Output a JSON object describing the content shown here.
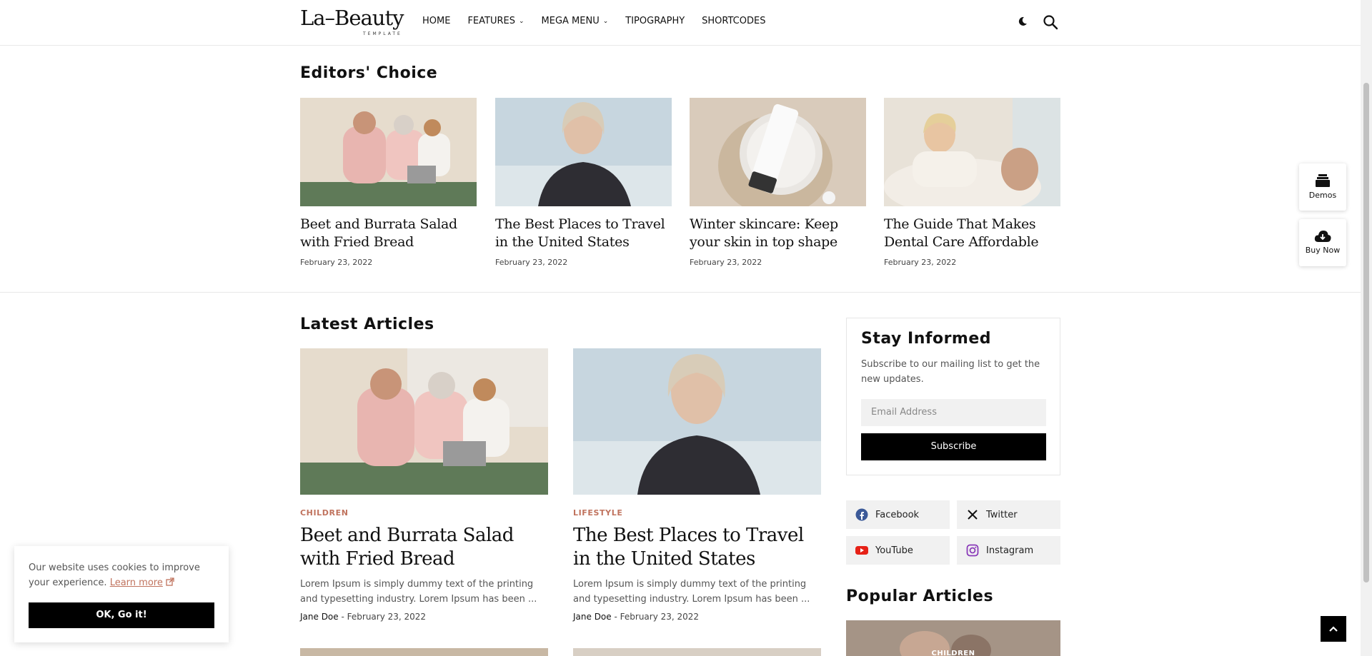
{
  "header": {
    "logo_text": "La–Beauty",
    "logo_sub": "TEMPLATE",
    "nav": [
      {
        "label": "HOME"
      },
      {
        "label": "FEATURES"
      },
      {
        "label": "MEGA MENU"
      },
      {
        "label": "TIPOGRAPHY"
      },
      {
        "label": "SHORTCODES"
      }
    ]
  },
  "editors": {
    "title": "Editors' Choice",
    "items": [
      {
        "title": "Beet and Burrata Salad with Fried Bread",
        "date": "February 23, 2022"
      },
      {
        "title": "The Best Places to Travel in the United States",
        "date": "February 23, 2022"
      },
      {
        "title": "Winter skincare: Keep your skin in top shape",
        "date": "February 23, 2022"
      },
      {
        "title": "The Guide That Makes Dental Care Affordable",
        "date": "February 23, 2022"
      }
    ]
  },
  "latest": {
    "title": "Latest Articles",
    "items": [
      {
        "category": "CHILDREN",
        "title": "Beet and Burrata Salad with Fried Bread",
        "excerpt": "Lorem Ipsum is simply dummy text of the printing and typesetting industry. Lorem Ipsum has been ...",
        "author": "Jane Doe",
        "date": "February 23, 2022"
      },
      {
        "category": "LIFESTYLE",
        "title": "The Best Places to Travel in the United States",
        "excerpt": "Lorem Ipsum is simply dummy text of the printing and typesetting industry. Lorem Ipsum has been ...",
        "author": "Jane Doe",
        "date": "February 23, 2022"
      }
    ]
  },
  "sidebar": {
    "subscribe_title": "Stay Informed",
    "subscribe_text": "Subscribe to our mailing list to get the new updates.",
    "email_placeholder": "Email Address",
    "subscribe_button": "Subscribe",
    "social": [
      {
        "label": "Facebook",
        "icon": "facebook-icon",
        "color": "#3b5998"
      },
      {
        "label": "Twitter",
        "icon": "x-icon",
        "color": "#111111"
      },
      {
        "label": "YouTube",
        "icon": "youtube-icon",
        "color": "#e62117"
      },
      {
        "label": "Instagram",
        "icon": "instagram-icon",
        "color": "#8a3ab9"
      }
    ],
    "popular_title": "Popular Articles",
    "popular_category": "CHILDREN"
  },
  "floating": {
    "demos_label": "Demos",
    "buy_label": "Buy Now"
  },
  "cookie": {
    "text": "Our website uses cookies to improve your experience.",
    "link": "Learn more",
    "button": "OK, Go it!"
  },
  "colors": {
    "accent": "#c0735e",
    "dark": "#000000"
  }
}
